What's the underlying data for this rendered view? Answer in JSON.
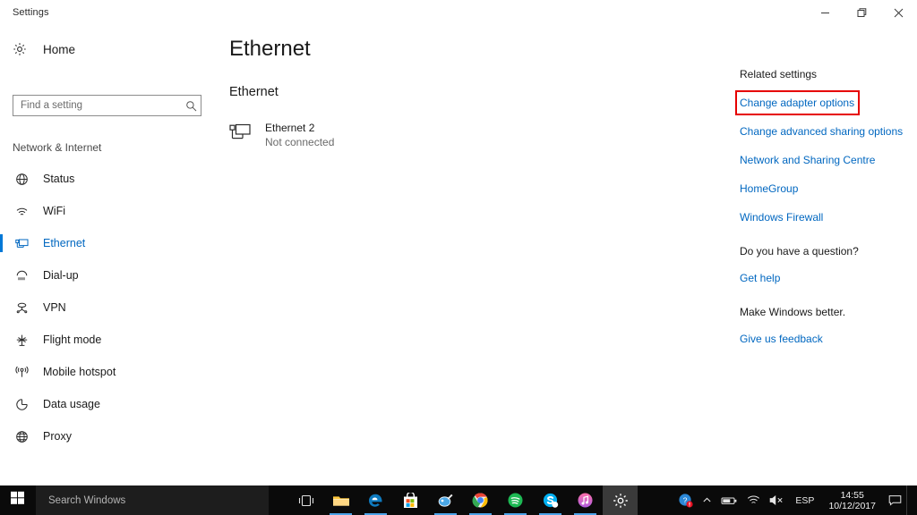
{
  "window": {
    "title": "Settings",
    "controls": {
      "minimize": "minimize-icon",
      "maximize": "restore-icon",
      "close": "close-icon"
    }
  },
  "sidebar": {
    "home_label": "Home",
    "home_icon": "gear-icon",
    "search": {
      "placeholder": "Find a setting",
      "value": "",
      "icon": "search-icon"
    },
    "category": "Network & Internet",
    "items": [
      {
        "label": "Status",
        "icon": "status-globe-icon",
        "active": false
      },
      {
        "label": "WiFi",
        "icon": "wifi-icon",
        "active": false
      },
      {
        "label": "Ethernet",
        "icon": "ethernet-icon",
        "active": true
      },
      {
        "label": "Dial-up",
        "icon": "dialup-icon",
        "active": false
      },
      {
        "label": "VPN",
        "icon": "vpn-icon",
        "active": false
      },
      {
        "label": "Flight mode",
        "icon": "airplane-icon",
        "active": false
      },
      {
        "label": "Mobile hotspot",
        "icon": "hotspot-icon",
        "active": false
      },
      {
        "label": "Data usage",
        "icon": "pie-chart-icon",
        "active": false
      },
      {
        "label": "Proxy",
        "icon": "globe-icon",
        "active": false
      }
    ]
  },
  "main": {
    "page_title": "Ethernet",
    "section_heading": "Ethernet",
    "adapter": {
      "icon": "ethernet-adapter-icon",
      "name": "Ethernet 2",
      "status": "Not connected"
    }
  },
  "right_panel": {
    "related_heading": "Related settings",
    "links": [
      {
        "label": "Change adapter options",
        "highlighted": true
      },
      {
        "label": "Change advanced sharing options",
        "highlighted": false
      },
      {
        "label": "Network and Sharing Centre",
        "highlighted": false
      },
      {
        "label": "HomeGroup",
        "highlighted": false
      },
      {
        "label": "Windows Firewall",
        "highlighted": false
      }
    ],
    "question_heading": "Do you have a question?",
    "question_link": "Get help",
    "feedback_heading": "Make Windows better.",
    "feedback_link": "Give us feedback"
  },
  "taskbar": {
    "start_icon": "windows-logo-icon",
    "search_placeholder": "Search Windows",
    "apps": [
      {
        "name": "task-view-icon",
        "running": false,
        "active": false
      },
      {
        "name": "file-explorer-icon",
        "running": true,
        "active": false
      },
      {
        "name": "microsoft-edge-icon",
        "running": true,
        "active": false
      },
      {
        "name": "microsoft-store-icon",
        "running": false,
        "active": false
      },
      {
        "name": "paint-3d-icon",
        "running": true,
        "active": false
      },
      {
        "name": "google-chrome-icon",
        "running": true,
        "active": false
      },
      {
        "name": "spotify-icon",
        "running": true,
        "active": false
      },
      {
        "name": "skype-icon",
        "running": true,
        "active": false
      },
      {
        "name": "itunes-icon",
        "running": true,
        "active": false
      },
      {
        "name": "settings-icon",
        "running": true,
        "active": true
      }
    ],
    "tray": {
      "help_icon": "help-alert-icon",
      "chevron_icon": "chevron-up-icon",
      "battery_icon": "battery-icon",
      "wifi_icon": "wifi-tray-icon",
      "volume_icon": "volume-muted-icon",
      "language": "ESP",
      "time": "14:55",
      "date": "10/12/2017",
      "notifications_icon": "notification-icon"
    }
  },
  "colors": {
    "accent": "#0078d7",
    "link": "#0067c0",
    "highlight_box": "#e60000",
    "taskbar_bg": "#0a0a0a"
  }
}
